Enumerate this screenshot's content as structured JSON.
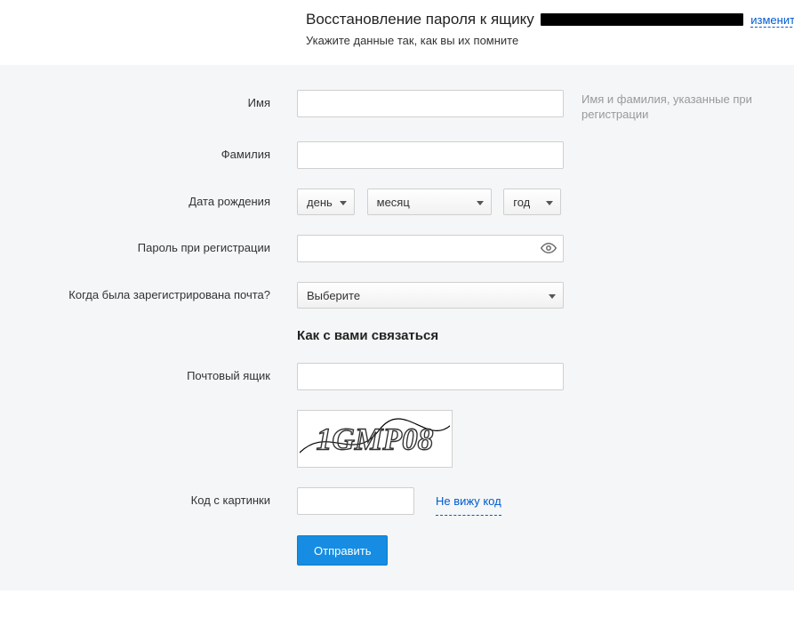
{
  "header": {
    "title_prefix": "Восстановление пароля к ящику ",
    "change_link": "изменить",
    "subtitle": "Укажите данные так, как вы их помните"
  },
  "labels": {
    "first_name": "Имя",
    "last_name": "Фамилия",
    "dob": "Дата рождения",
    "reg_password": "Пароль при регистрации",
    "when_registered": "Когда была зарегистрирована почта?",
    "mailbox": "Почтовый ящик",
    "captcha": "Код с картинки"
  },
  "hints": {
    "name": "Имя и фамилия, указанные при регистрации"
  },
  "selects": {
    "day": "день",
    "month": "месяц",
    "year": "год",
    "when_registered_selected": "Выберите"
  },
  "section_contact": "Как с вами связаться",
  "captcha": {
    "text": "1GMP08",
    "refresh": "Не вижу код"
  },
  "submit": "Отправить"
}
